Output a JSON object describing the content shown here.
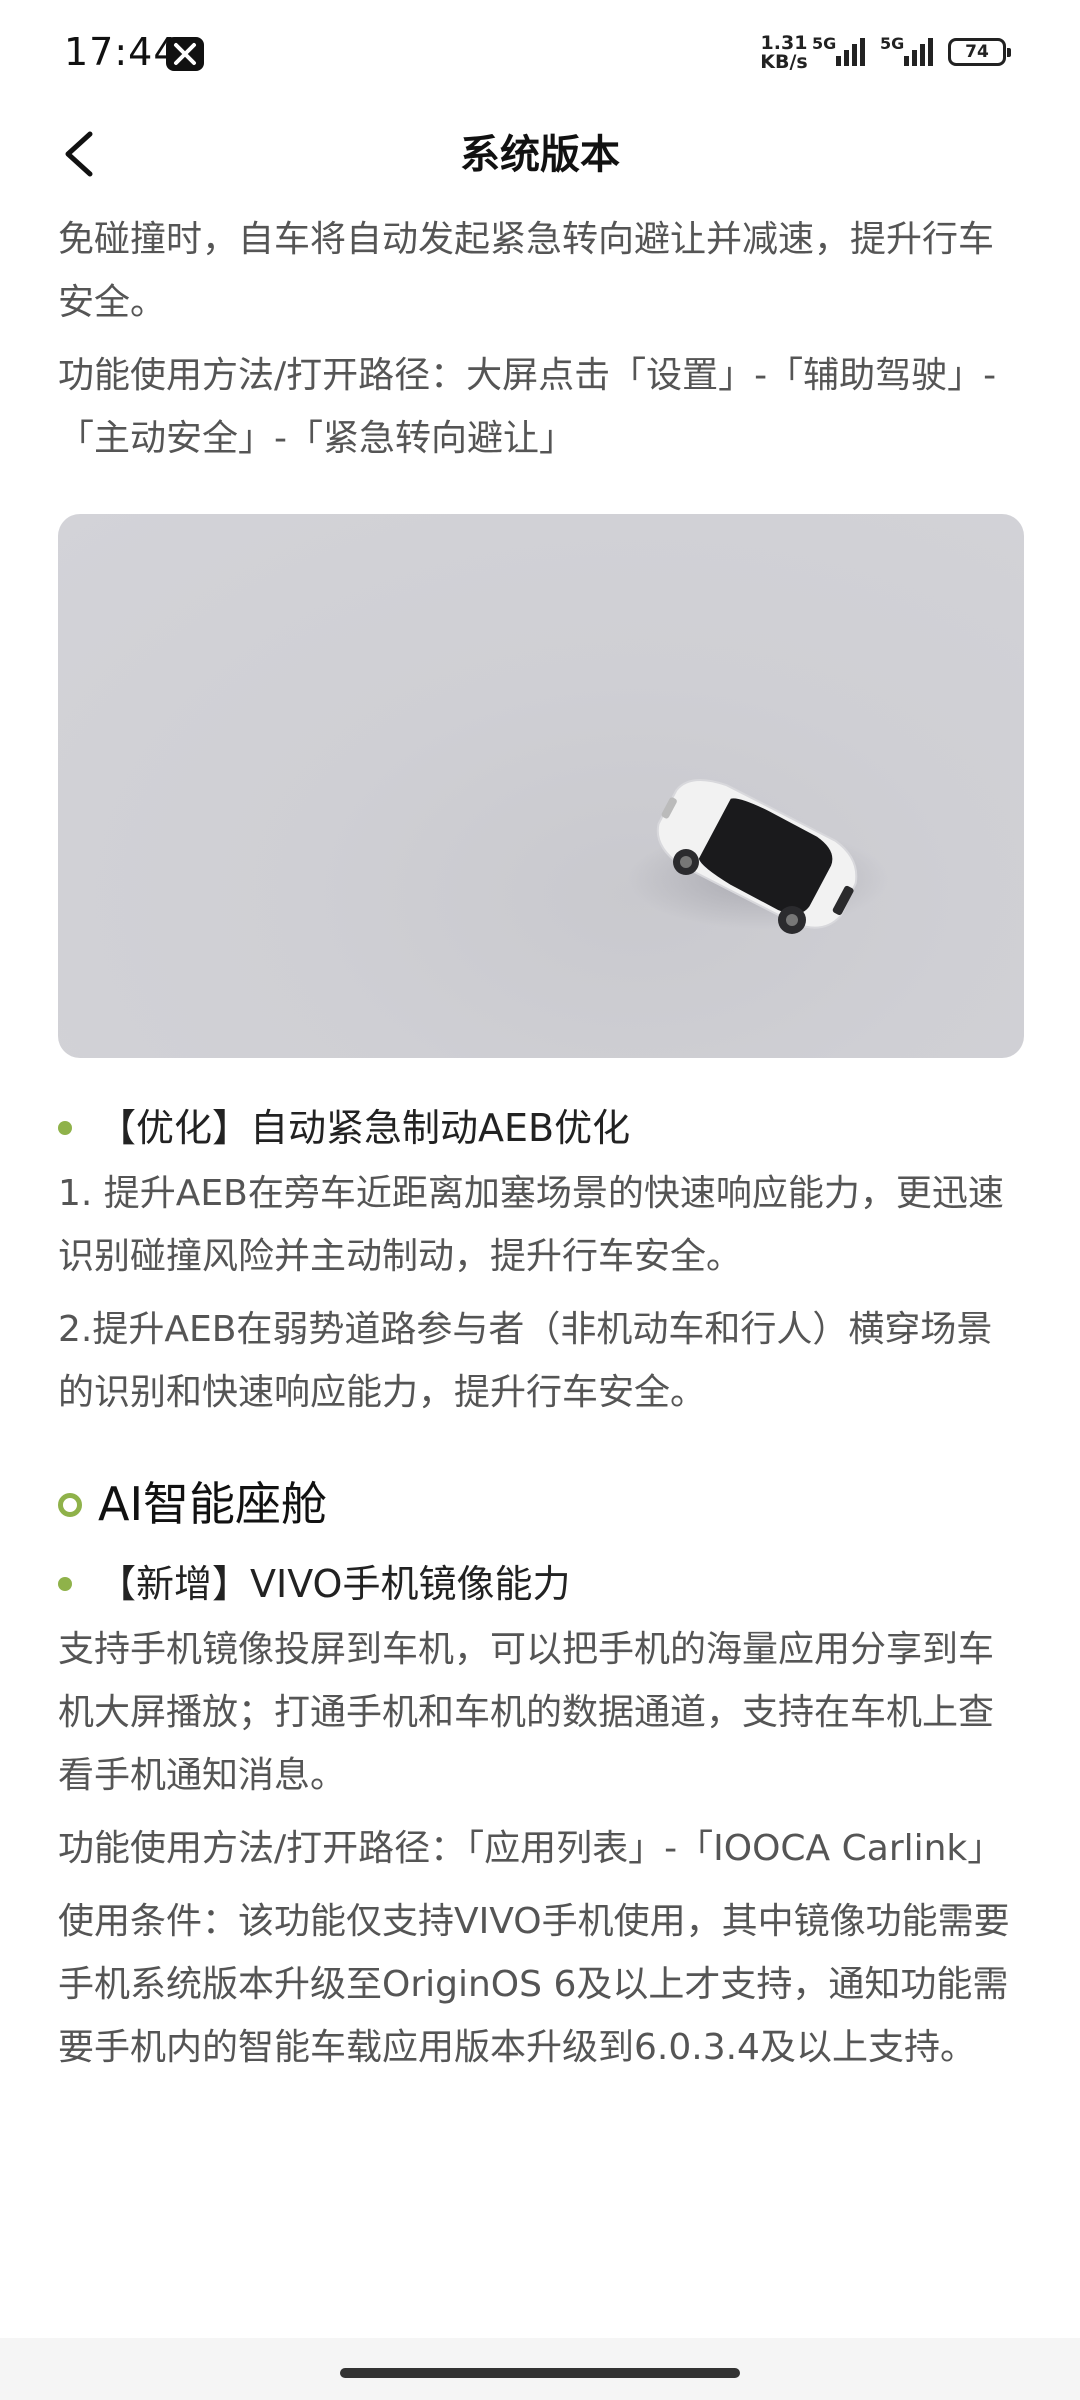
{
  "status_bar": {
    "time": "17:44",
    "net_speed_value": "1.31",
    "net_speed_unit": "KB/s",
    "signal1_label": "5G",
    "signal2_label": "5G",
    "battery": "74"
  },
  "header": {
    "title": "系统版本"
  },
  "content": {
    "intro_p1": "免碰撞时，自车将自动发起紧急转向避让并减速，提升行车安全。",
    "intro_p2": "功能使用方法/打开路径：大屏点击「设置」-「辅助驾驶」-「主动安全」-「紧急转向避让」",
    "aeb_title": "【优化】自动紧急制动AEB优化",
    "aeb_p1": "1. 提升AEB在旁车近距离加塞场景的快速响应能力，更迅速识别碰撞风险并主动制动，提升行车安全。",
    "aeb_p2": "2.提升AEB在弱势道路参与者（非机动车和行人）横穿场景的识别和快速响应能力，提升行车安全。",
    "section_title": "AI智能座舱",
    "vivo_title": "【新增】VIVO手机镜像能力",
    "vivo_p1": "支持手机镜像投屏到车机，可以把手机的海量应用分享到车机大屏播放；打通手机和车机的数据通道，支持在车机上查看手机通知消息。",
    "vivo_p2": "功能使用方法/打开路径：「应用列表」-「IOOCA Carlink」",
    "vivo_p3": "使用条件：该功能仅支持VIVO手机使用，其中镜像功能需要手机系统版本升级至OriginOS 6及以上才支持，通知功能需要手机内的智能车载应用版本升级到6.0.3.4及以上支持。"
  },
  "colors": {
    "accent_green": "#8fb24a",
    "body_text": "#555555",
    "hero_bg": "#cfcfd4"
  },
  "icons": {
    "back": "chevron-left-icon",
    "app_badge": "x-app-icon",
    "hero": "white-suv-car-image"
  }
}
